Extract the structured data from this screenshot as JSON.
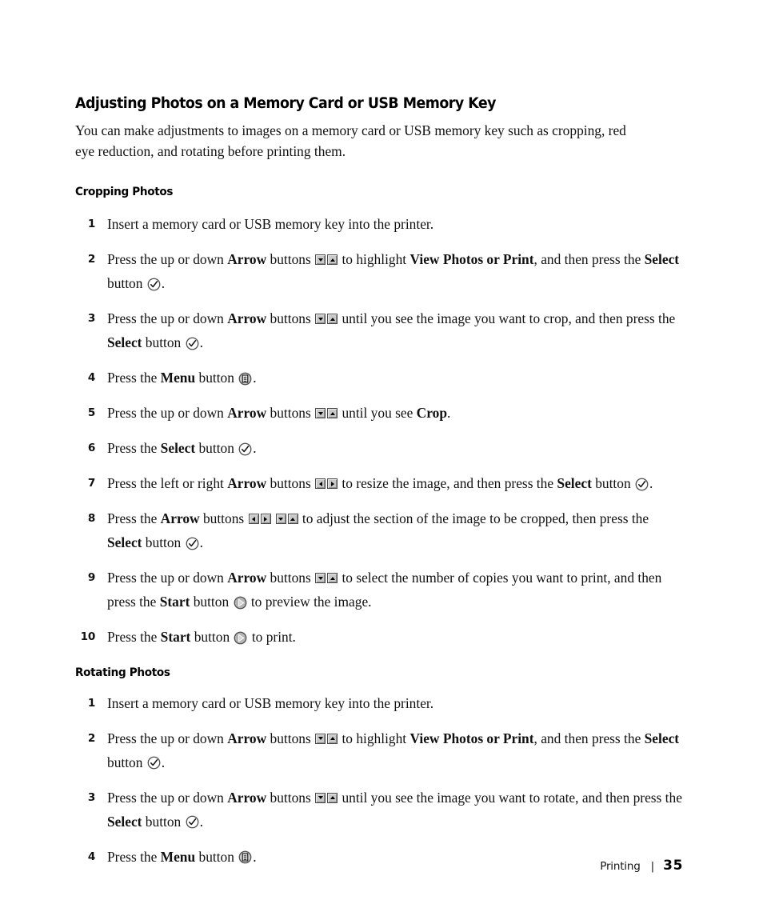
{
  "document": {
    "title": "Adjusting Photos on a Memory Card or USB Memory Key",
    "intro": "You can make adjustments to images on a memory card or USB memory key such as cropping, red eye reduction, and rotating before printing them."
  },
  "sections": [
    {
      "heading": "Cropping Photos",
      "steps": [
        {
          "number": "1",
          "parts": [
            {
              "type": "text",
              "value": "Insert a memory card or USB memory key into the printer."
            }
          ]
        },
        {
          "number": "2",
          "parts": [
            {
              "type": "text",
              "value": "Press the up or down "
            },
            {
              "type": "bold",
              "value": "Arrow"
            },
            {
              "type": "text",
              "value": " buttons "
            },
            {
              "type": "icon",
              "value": "arrow-down-button"
            },
            {
              "type": "icon",
              "value": "arrow-up-button"
            },
            {
              "type": "text",
              "value": " to highlight "
            },
            {
              "type": "bold",
              "value": "View Photos or Print"
            },
            {
              "type": "text",
              "value": ", and then press the "
            },
            {
              "type": "bold",
              "value": "Select"
            },
            {
              "type": "text",
              "value": " button "
            },
            {
              "type": "icon",
              "value": "select-check-icon"
            },
            {
              "type": "text",
              "value": "."
            }
          ]
        },
        {
          "number": "3",
          "parts": [
            {
              "type": "text",
              "value": "Press the up or down "
            },
            {
              "type": "bold",
              "value": "Arrow"
            },
            {
              "type": "text",
              "value": " buttons "
            },
            {
              "type": "icon",
              "value": "arrow-down-button"
            },
            {
              "type": "icon",
              "value": "arrow-up-button"
            },
            {
              "type": "text",
              "value": " until you see the image you want to crop, and then press the "
            },
            {
              "type": "bold",
              "value": "Select"
            },
            {
              "type": "text",
              "value": " button "
            },
            {
              "type": "icon",
              "value": "select-check-icon"
            },
            {
              "type": "text",
              "value": "."
            }
          ]
        },
        {
          "number": "4",
          "parts": [
            {
              "type": "text",
              "value": "Press the "
            },
            {
              "type": "bold",
              "value": "Menu"
            },
            {
              "type": "text",
              "value": " button "
            },
            {
              "type": "icon",
              "value": "menu-icon"
            },
            {
              "type": "text",
              "value": "."
            }
          ]
        },
        {
          "number": "5",
          "parts": [
            {
              "type": "text",
              "value": "Press the up or down "
            },
            {
              "type": "bold",
              "value": "Arrow"
            },
            {
              "type": "text",
              "value": " buttons "
            },
            {
              "type": "icon",
              "value": "arrow-down-button"
            },
            {
              "type": "icon",
              "value": "arrow-up-button"
            },
            {
              "type": "text",
              "value": " until you see "
            },
            {
              "type": "bold",
              "value": "Crop"
            },
            {
              "type": "text",
              "value": "."
            }
          ]
        },
        {
          "number": "6",
          "parts": [
            {
              "type": "text",
              "value": "Press the "
            },
            {
              "type": "bold",
              "value": "Select"
            },
            {
              "type": "text",
              "value": " button "
            },
            {
              "type": "icon",
              "value": "select-check-icon"
            },
            {
              "type": "text",
              "value": "."
            }
          ]
        },
        {
          "number": "7",
          "parts": [
            {
              "type": "text",
              "value": "Press the left or right "
            },
            {
              "type": "bold",
              "value": "Arrow"
            },
            {
              "type": "text",
              "value": " buttons "
            },
            {
              "type": "icon",
              "value": "arrow-left-button"
            },
            {
              "type": "icon",
              "value": "arrow-right-button"
            },
            {
              "type": "text",
              "value": " to resize the image, and then press the "
            },
            {
              "type": "bold",
              "value": "Select"
            },
            {
              "type": "text",
              "value": " button "
            },
            {
              "type": "icon",
              "value": "select-check-icon"
            },
            {
              "type": "text",
              "value": "."
            }
          ]
        },
        {
          "number": "8",
          "parts": [
            {
              "type": "text",
              "value": "Press the "
            },
            {
              "type": "bold",
              "value": "Arrow"
            },
            {
              "type": "text",
              "value": " buttons "
            },
            {
              "type": "icon",
              "value": "arrow-left-button"
            },
            {
              "type": "icon",
              "value": "arrow-right-button"
            },
            {
              "type": "gap",
              "value": ""
            },
            {
              "type": "icon",
              "value": "arrow-down-button"
            },
            {
              "type": "icon",
              "value": "arrow-up-button"
            },
            {
              "type": "text",
              "value": " to adjust the section of the image to be cropped, then press the "
            },
            {
              "type": "bold",
              "value": "Select"
            },
            {
              "type": "text",
              "value": " button "
            },
            {
              "type": "icon",
              "value": "select-check-icon"
            },
            {
              "type": "text",
              "value": "."
            }
          ]
        },
        {
          "number": "9",
          "parts": [
            {
              "type": "text",
              "value": "Press the up or down "
            },
            {
              "type": "bold",
              "value": "Arrow"
            },
            {
              "type": "text",
              "value": " buttons "
            },
            {
              "type": "icon",
              "value": "arrow-down-button"
            },
            {
              "type": "icon",
              "value": "arrow-up-button"
            },
            {
              "type": "text",
              "value": " to select the number of copies you want to print, and then press the "
            },
            {
              "type": "bold",
              "value": "Start"
            },
            {
              "type": "text",
              "value": " button "
            },
            {
              "type": "icon",
              "value": "start-play-icon"
            },
            {
              "type": "text",
              "value": " to preview the image."
            }
          ]
        },
        {
          "number": "10",
          "parts": [
            {
              "type": "text",
              "value": "Press the "
            },
            {
              "type": "bold",
              "value": "Start"
            },
            {
              "type": "text",
              "value": " button "
            },
            {
              "type": "icon",
              "value": "start-play-icon"
            },
            {
              "type": "text",
              "value": " to print."
            }
          ]
        }
      ]
    },
    {
      "heading": "Rotating Photos",
      "steps": [
        {
          "number": "1",
          "parts": [
            {
              "type": "text",
              "value": "Insert a memory card or USB memory key into the printer."
            }
          ]
        },
        {
          "number": "2",
          "parts": [
            {
              "type": "text",
              "value": "Press the up or down "
            },
            {
              "type": "bold",
              "value": "Arrow"
            },
            {
              "type": "text",
              "value": " buttons "
            },
            {
              "type": "icon",
              "value": "arrow-down-button"
            },
            {
              "type": "icon",
              "value": "arrow-up-button"
            },
            {
              "type": "text",
              "value": " to highlight "
            },
            {
              "type": "bold",
              "value": "View Photos or Print"
            },
            {
              "type": "text",
              "value": ", and then press the "
            },
            {
              "type": "bold",
              "value": "Select"
            },
            {
              "type": "text",
              "value": " button "
            },
            {
              "type": "icon",
              "value": "select-check-icon"
            },
            {
              "type": "text",
              "value": "."
            }
          ]
        },
        {
          "number": "3",
          "parts": [
            {
              "type": "text",
              "value": "Press the up or down "
            },
            {
              "type": "bold",
              "value": "Arrow"
            },
            {
              "type": "text",
              "value": " buttons "
            },
            {
              "type": "icon",
              "value": "arrow-down-button"
            },
            {
              "type": "icon",
              "value": "arrow-up-button"
            },
            {
              "type": "text",
              "value": " until you see the image you want to rotate, and then press the "
            },
            {
              "type": "bold",
              "value": "Select"
            },
            {
              "type": "text",
              "value": " button "
            },
            {
              "type": "icon",
              "value": "select-check-icon"
            },
            {
              "type": "text",
              "value": "."
            }
          ]
        },
        {
          "number": "4",
          "parts": [
            {
              "type": "text",
              "value": "Press the "
            },
            {
              "type": "bold",
              "value": "Menu"
            },
            {
              "type": "text",
              "value": " button "
            },
            {
              "type": "icon",
              "value": "menu-icon"
            },
            {
              "type": "text",
              "value": "."
            }
          ]
        }
      ]
    }
  ],
  "footer": {
    "section_label": "Printing",
    "separator": "|",
    "page_number": "35"
  },
  "colors": {
    "text": "#111111",
    "key_face": "#c9c9c9",
    "key_border": "#4a4a4a",
    "icon_fill": "#b5b5b5"
  }
}
